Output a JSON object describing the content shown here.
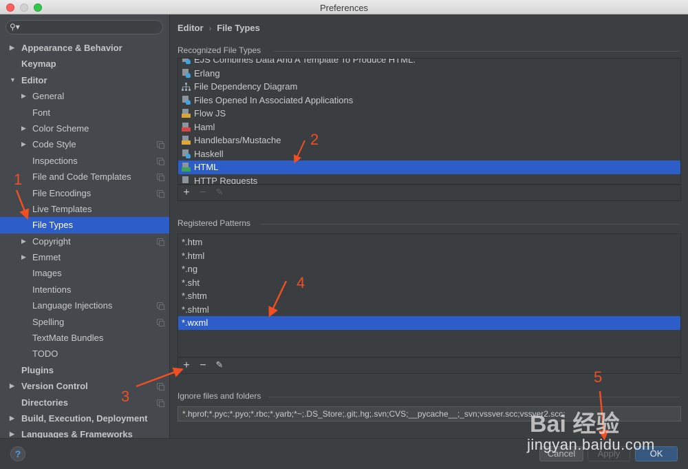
{
  "window": {
    "title": "Preferences"
  },
  "sidebar": {
    "search": {
      "placeholder": "",
      "icon": "search-icon"
    },
    "items": [
      {
        "label": "Appearance & Behavior",
        "level": 0,
        "arrow": "right",
        "bold": true,
        "copy": false
      },
      {
        "label": "Keymap",
        "level": 0,
        "arrow": "",
        "bold": true,
        "copy": false
      },
      {
        "label": "Editor",
        "level": 0,
        "arrow": "down",
        "bold": true,
        "copy": false
      },
      {
        "label": "General",
        "level": 1,
        "arrow": "right",
        "bold": false,
        "copy": false
      },
      {
        "label": "Font",
        "level": 1,
        "arrow": "",
        "bold": false,
        "copy": false
      },
      {
        "label": "Color Scheme",
        "level": 1,
        "arrow": "right",
        "bold": false,
        "copy": false
      },
      {
        "label": "Code Style",
        "level": 1,
        "arrow": "right",
        "bold": false,
        "copy": true
      },
      {
        "label": "Inspections",
        "level": 1,
        "arrow": "",
        "bold": false,
        "copy": true
      },
      {
        "label": "File and Code Templates",
        "level": 1,
        "arrow": "",
        "bold": false,
        "copy": true
      },
      {
        "label": "File Encodings",
        "level": 1,
        "arrow": "",
        "bold": false,
        "copy": true
      },
      {
        "label": "Live Templates",
        "level": 1,
        "arrow": "",
        "bold": false,
        "copy": false
      },
      {
        "label": "File Types",
        "level": 1,
        "arrow": "",
        "bold": false,
        "copy": false,
        "selected": true
      },
      {
        "label": "Copyright",
        "level": 1,
        "arrow": "right",
        "bold": false,
        "copy": true
      },
      {
        "label": "Emmet",
        "level": 1,
        "arrow": "right",
        "bold": false,
        "copy": false
      },
      {
        "label": "Images",
        "level": 1,
        "arrow": "",
        "bold": false,
        "copy": false
      },
      {
        "label": "Intentions",
        "level": 1,
        "arrow": "",
        "bold": false,
        "copy": false
      },
      {
        "label": "Language Injections",
        "level": 1,
        "arrow": "",
        "bold": false,
        "copy": true
      },
      {
        "label": "Spelling",
        "level": 1,
        "arrow": "",
        "bold": false,
        "copy": true
      },
      {
        "label": "TextMate Bundles",
        "level": 1,
        "arrow": "",
        "bold": false,
        "copy": false
      },
      {
        "label": "TODO",
        "level": 1,
        "arrow": "",
        "bold": false,
        "copy": false
      },
      {
        "label": "Plugins",
        "level": 0,
        "arrow": "",
        "bold": true,
        "copy": false
      },
      {
        "label": "Version Control",
        "level": 0,
        "arrow": "right",
        "bold": true,
        "copy": true
      },
      {
        "label": "Directories",
        "level": 0,
        "arrow": "",
        "bold": true,
        "copy": true
      },
      {
        "label": "Build, Execution, Deployment",
        "level": 0,
        "arrow": "right",
        "bold": true,
        "copy": false
      },
      {
        "label": "Languages & Frameworks",
        "level": 0,
        "arrow": "right",
        "bold": true,
        "copy": false
      }
    ]
  },
  "breadcrumb": {
    "parent": "Editor",
    "separator": "›",
    "current": "File Types"
  },
  "recognized": {
    "title": "Recognized File Types",
    "items": [
      {
        "label": "EJS Combines Data And A Template To Produce HTML.",
        "icon": "generic",
        "selected": false
      },
      {
        "label": "Erlang",
        "icon": "generic",
        "selected": false
      },
      {
        "label": "File Dependency Diagram",
        "icon": "diagram",
        "selected": false
      },
      {
        "label": "Files Opened In Associated Applications",
        "icon": "generic",
        "selected": false
      },
      {
        "label": "Flow JS",
        "icon": "js",
        "selected": false
      },
      {
        "label": "Haml",
        "icon": "haml",
        "selected": false
      },
      {
        "label": "Handlebars/Mustache",
        "icon": "handlebars",
        "selected": false
      },
      {
        "label": "Haskell",
        "icon": "generic",
        "selected": false
      },
      {
        "label": "HTML",
        "icon": "html",
        "selected": true
      },
      {
        "label": "HTTP Requests",
        "icon": "plain",
        "selected": false
      }
    ]
  },
  "patterns": {
    "title": "Registered Patterns",
    "items": [
      {
        "label": "*.htm",
        "selected": false
      },
      {
        "label": "*.html",
        "selected": false
      },
      {
        "label": "*.ng",
        "selected": false
      },
      {
        "label": "*.sht",
        "selected": false
      },
      {
        "label": "*.shtm",
        "selected": false
      },
      {
        "label": "*.shtml",
        "selected": false
      },
      {
        "label": "*.wxml",
        "selected": true
      }
    ]
  },
  "toolbar": {
    "add": "+",
    "remove": "−",
    "edit": "✎"
  },
  "ignore": {
    "title": "Ignore files and folders",
    "value": "*.hprof;*.pyc;*.pyo;*.rbc;*.yarb;*~;.DS_Store;.git;.hg;.svn;CVS;__pycache__;_svn;vssver.scc;vssver2.scc;"
  },
  "buttons": {
    "help": "?",
    "cancel": "Cancel",
    "apply": "Apply",
    "ok": "OK"
  },
  "annotations": [
    "1",
    "2",
    "3",
    "4",
    "5"
  ],
  "watermark": {
    "brand": "Bai 经验",
    "url": "jingyan.baidu.com"
  },
  "colors": {
    "selection": "#2d5dc8",
    "annotation": "#f04e23",
    "ok_button": "#365880"
  }
}
